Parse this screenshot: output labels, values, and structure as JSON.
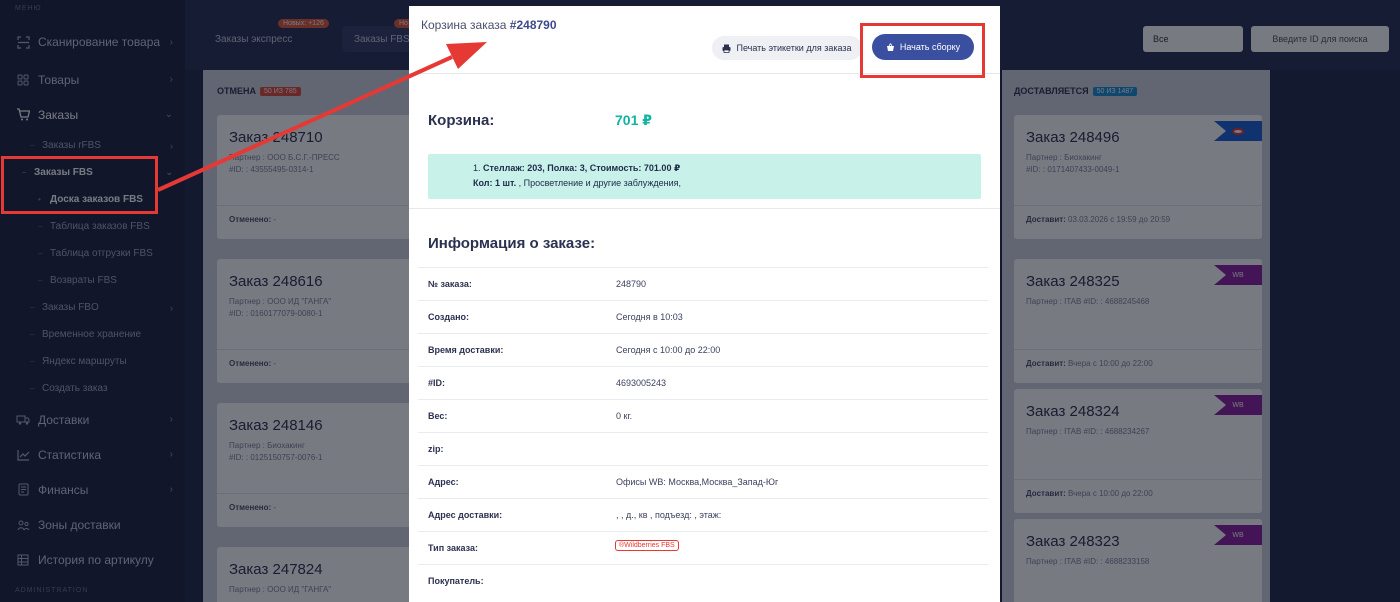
{
  "sidebar": {
    "menu_label": "МЕНЮ",
    "items": [
      {
        "label": "Сканирование товара",
        "icon": "scan-icon"
      },
      {
        "label": "Товары",
        "icon": "grid-icon"
      },
      {
        "label": "Заказы",
        "icon": "cart-icon"
      }
    ],
    "orders_sub": [
      {
        "label": "Заказы rFBS"
      },
      {
        "label": "Заказы FBS"
      }
    ],
    "fbs_sub": [
      {
        "label": "Доска заказов FBS"
      },
      {
        "label": "Таблица заказов FBS"
      },
      {
        "label": "Таблица отгрузки FBS"
      },
      {
        "label": "Возвраты FBS"
      }
    ],
    "orders_more": [
      {
        "label": "Заказы FBO"
      },
      {
        "label": "Временное хранение"
      },
      {
        "label": "Яндекс маршруты"
      },
      {
        "label": "Создать заказ"
      }
    ],
    "bottom_items": [
      {
        "label": "Доставки",
        "icon": "truck-icon"
      },
      {
        "label": "Статистика",
        "icon": "chart-icon"
      },
      {
        "label": "Финансы",
        "icon": "document-icon"
      },
      {
        "label": "Зоны доставки",
        "icon": "map-pin-icon"
      },
      {
        "label": "История по артикулу",
        "icon": "table-icon"
      }
    ],
    "admin_label": "ADMINISTRATION"
  },
  "topbar": {
    "tab_express": "Заказы экспресс",
    "tab_express_badge": "Новых: +126",
    "tab_fbs": "Заказы FBS",
    "tab_fbs_badge": "Но",
    "filter_value": "Все",
    "search_placeholder": "Введите ID для поиска"
  },
  "board": {
    "left_column": {
      "title": "ОТМЕНА",
      "badge": "50 ИЗ 785",
      "cards": [
        {
          "title": "Заказ 248710",
          "partner": "Партнер : ООО Б.С.Г.-ПРЕСС",
          "id": "#ID: : 43555495-0314-1",
          "footer_label": "Отменено:",
          "footer_value": "-"
        },
        {
          "title": "Заказ 248616",
          "partner": "Партнер : ООО ИД \"ГАНГА\"",
          "id": "#ID: : 0160177079-0080-1",
          "footer_label": "Отменено:",
          "footer_value": "-"
        },
        {
          "title": "Заказ 248146",
          "partner": "Партнер : Биохакинг",
          "id": "#ID: : 0125150757-0076-1",
          "footer_label": "Отменено:",
          "footer_value": "-"
        },
        {
          "title": "Заказ 247824",
          "partner": "Партнер : ООО ИД \"ГАНГА\"",
          "id": "",
          "footer_label": "",
          "footer_value": ""
        }
      ]
    },
    "right_column": {
      "title": "ДОСТАВЛЯЕТСЯ",
      "badge": "50 ИЗ 1487",
      "cards": [
        {
          "title": "Заказ 248496",
          "partner": "Партнер : Биохакинг",
          "id": "#ID: : 0171407433-0049-1",
          "footer_label": "Доставит:",
          "footer_value": "03.03.2026 с 19:59 до 20:59",
          "marketplace": "ozon"
        },
        {
          "title": "Заказ 248325",
          "partner": "Партнер : ITAB  #ID: : 4688245468",
          "id": "",
          "footer_label": "Доставит:",
          "footer_value": "Вчера с 10:00 до 22:00",
          "marketplace": "WB"
        },
        {
          "title": "Заказ 248324",
          "partner": "Партнер : ITAB  #ID: : 4688234267",
          "id": "",
          "footer_label": "Доставит:",
          "footer_value": "Вчера с 10:00 до 22:00",
          "marketplace": "WB"
        },
        {
          "title": "Заказ 248323",
          "partner": "Партнер : ITAB  #ID: : 4688233158",
          "id": "",
          "footer_label": "",
          "footer_value": "",
          "marketplace": "WB"
        }
      ]
    }
  },
  "modal": {
    "title_prefix": "Корзина заказа",
    "order_number": "#248790",
    "print_label": "Печать этикетки для заказа",
    "start_label": "Начать сборку",
    "cart_label": "Корзина:",
    "cart_sum": "701 ₽",
    "cart_line1_prefix": "1. ",
    "cart_line1_bold": "Стеллаж: 203, Полка: 3, Стоимость: 701.00 ₽",
    "cart_line2_bold": "Кол: 1 шт.",
    "cart_line2_rest": " , Просветление и другие заблуждения,",
    "info_title": "Информация о заказе:",
    "info_rows": [
      {
        "label": "№ заказа:",
        "value": "248790"
      },
      {
        "label": "Создано:",
        "value": "Сегодня в 10:03"
      },
      {
        "label": "Время доставки:",
        "value": "Сегодня с 10:00 до 22:00"
      },
      {
        "label": "#ID:",
        "value": "4693005243"
      },
      {
        "label": "Вес:",
        "value": "0 кг."
      },
      {
        "label": "zip:",
        "value": ""
      },
      {
        "label": "Адрес:",
        "value": "Офисы WB: Москва,Москва_Запад-Юг"
      },
      {
        "label": "Адрес доставки:",
        "value": ", , д., кв , подъезд: , этаж:"
      },
      {
        "label": "Тип заказа:",
        "value": "",
        "pill": "®Wildberries FBS"
      },
      {
        "label": "Покупатель:",
        "value": ""
      }
    ]
  },
  "colors": {
    "sidebar_bg": "#1c2340",
    "accent": "#3a4fa0",
    "highlight_red": "#e53935",
    "cart_sum": "#12b3a0",
    "cart_box": "#c8f1ea",
    "wb": "#8d1fa0",
    "ozon": "#1a5fd8"
  }
}
